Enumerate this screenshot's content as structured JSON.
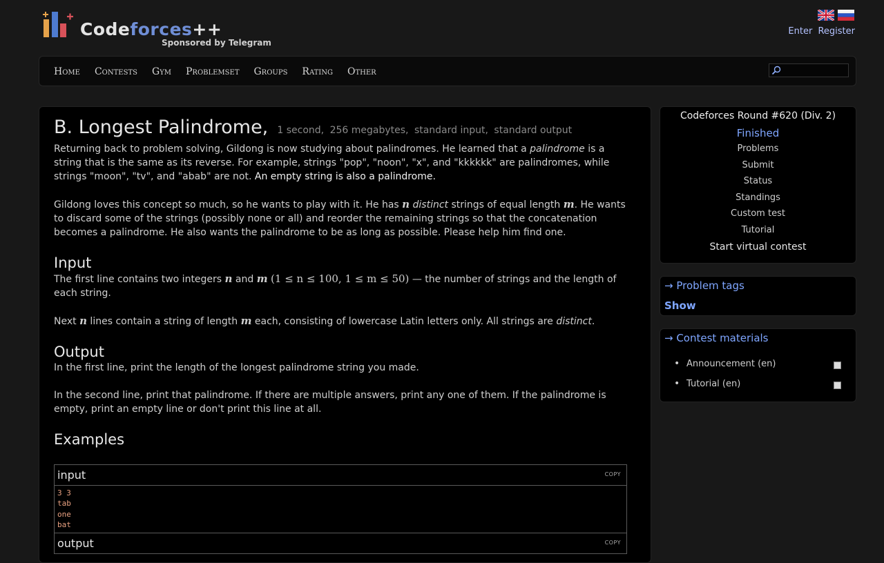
{
  "header": {
    "logo_title_prefix": "Code",
    "logo_title_accent": "forces",
    "logo_title_suffix": "++",
    "sponsor": "Sponsored by Telegram",
    "enter": "Enter",
    "register": "Register"
  },
  "menu": {
    "items": [
      "Home",
      "Contests",
      "Gym",
      "Problemset",
      "Groups",
      "Rating",
      "Other"
    ],
    "search_placeholder": ""
  },
  "problem": {
    "title": "B. Longest Palindrome,",
    "time_limit": "1 second,",
    "memory_limit": "256 megabytes,",
    "input_type": "standard input,",
    "output_type": "standard output",
    "statement_p1_a": "Returning back to problem solving, Gildong is now studying about palindromes. He learned that a ",
    "statement_p1_em": "palindrome",
    "statement_p1_b": " is a string that is the same as its reverse. For example, strings \"pop\", \"noon\", \"x\", and \"kkkkkk\" are palindromes, while strings \"moon\", \"tv\", and \"abab\" are not. ",
    "statement_p1_bright": "An empty string is also a palindrome.",
    "statement_p2_a": "Gildong loves this concept so much, so he wants to play with it. He has ",
    "statement_p2_n": "n",
    "statement_p2_em": "distinct",
    "statement_p2_b": " strings of equal length ",
    "statement_p2_m": "m",
    "statement_p2_c": ". He wants to discard some of the strings (possibly none or all) and reorder the remaining strings so that the concatenation becomes a palindrome. He also wants the palindrome to be as long as possible. Please help him find one.",
    "input_heading": "Input",
    "input_p1_a": "The first line contains two integers ",
    "input_p1_n": "n",
    "input_p1_and": " and ",
    "input_p1_m": "m",
    "input_p1_constraint": "(1 ≤ n ≤ 100, 1 ≤ m ≤ 50)",
    "input_p1_b": " — the number of strings and the length of each string.",
    "input_p2_a": "Next ",
    "input_p2_n": "n",
    "input_p2_b": " lines contain a string of length ",
    "input_p2_m": "m",
    "input_p2_c": " each, consisting of lowercase Latin letters only. All strings are ",
    "input_p2_em": "distinct",
    "input_p2_d": ".",
    "output_heading": "Output",
    "output_p1": "In the first line, print the length of the longest palindrome string you made.",
    "output_p2": "In the second line, print that palindrome. If there are multiple answers, print any one of them. If the palindrome is empty, print an empty line or don't print this line at all.",
    "examples_heading": "Examples",
    "example_input_label": "input",
    "example_output_label": "output",
    "copy_label": "COPY",
    "example_input_lines": [
      "3 3",
      "tab",
      "one",
      "bat"
    ]
  },
  "sidebar": {
    "contest_name": "Codeforces Round #620 (Div. 2)",
    "contest_status": "Finished",
    "links": [
      "Problems",
      "Submit",
      "Status",
      "Standings",
      "Custom test",
      "Tutorial"
    ],
    "virtual": "Start virtual contest",
    "tags_caption": "→ Problem tags",
    "tags_show": "Show",
    "materials_caption": "→ Contest materials",
    "materials": [
      "Announcement (en)",
      "Tutorial (en)"
    ]
  },
  "colors": {
    "accent": "#7fa6ff",
    "background": "#181818",
    "panel": "#000000",
    "sample_text": "#e7a080"
  }
}
